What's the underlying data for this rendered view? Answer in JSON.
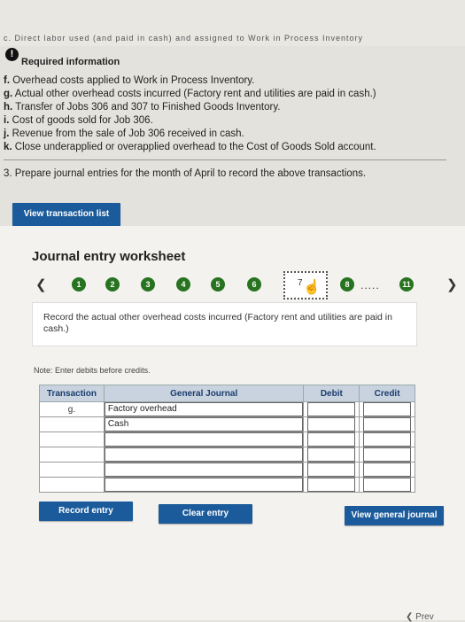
{
  "header": {
    "cut_text": "c. Direct labor used (and paid in cash) and assigned to Work in Process Inventory",
    "required_title": "Required information"
  },
  "info_items": [
    {
      "letter": "f.",
      "text": "Overhead costs applied to Work in Process Inventory."
    },
    {
      "letter": "g.",
      "text": "Actual other overhead costs incurred (Factory rent and utilities are paid in cash.)"
    },
    {
      "letter": "h.",
      "text": "Transfer of Jobs 306 and 307 to Finished Goods Inventory."
    },
    {
      "letter": "i.",
      "text": "Cost of goods sold for Job 306."
    },
    {
      "letter": "j.",
      "text": "Revenue from the sale of Job 306 received in cash."
    },
    {
      "letter": "k.",
      "text": "Close underapplied or overapplied overhead to the Cost of Goods Sold account."
    }
  ],
  "prompt": "3. Prepare journal entries for the month of April to record the above transactions.",
  "buttons": {
    "view_transaction_list": "View transaction list",
    "record_entry": "Record entry",
    "clear_entry": "Clear entry",
    "view_general_journal": "View general journal"
  },
  "worksheet": {
    "title": "Journal entry worksheet",
    "steps": [
      "1",
      "2",
      "3",
      "4",
      "5",
      "6",
      "7",
      "8",
      "11"
    ],
    "current_step": "7",
    "dots": ".....",
    "description": "Record the actual other overhead costs incurred (Factory rent and utilities are paid in cash.)",
    "note": "Note: Enter debits before credits."
  },
  "journal": {
    "headers": {
      "transaction": "Transaction",
      "general_journal": "General Journal",
      "debit": "Debit",
      "credit": "Credit"
    },
    "rows": [
      {
        "transaction": "g.",
        "account": "Factory overhead",
        "debit": "",
        "credit": ""
      },
      {
        "transaction": "",
        "account": "Cash",
        "debit": "",
        "credit": ""
      },
      {
        "transaction": "",
        "account": "",
        "debit": "",
        "credit": ""
      },
      {
        "transaction": "",
        "account": "",
        "debit": "",
        "credit": ""
      },
      {
        "transaction": "",
        "account": "",
        "debit": "",
        "credit": ""
      },
      {
        "transaction": "",
        "account": "",
        "debit": "",
        "credit": ""
      }
    ]
  },
  "footer": {
    "prev": "Prev"
  },
  "colors": {
    "button": "#1b5b9b",
    "step_done": "#27731f",
    "table_header": "#c9d3e0"
  }
}
